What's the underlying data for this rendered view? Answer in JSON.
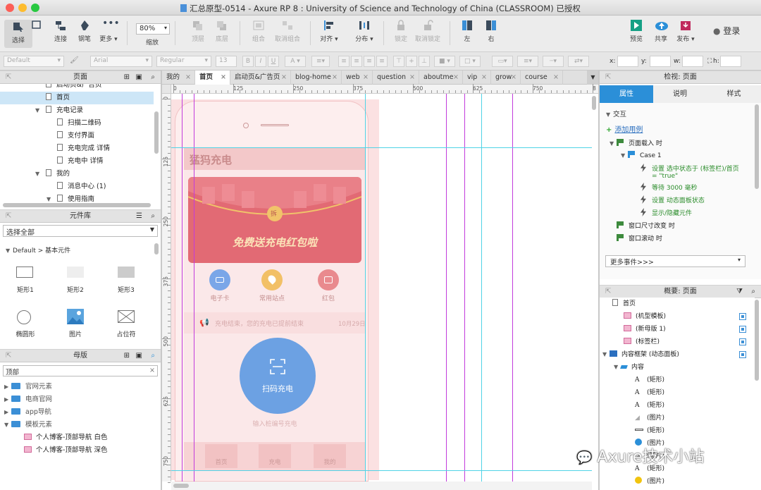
{
  "window": {
    "title": "汇总原型-0514 - Axure RP 8 : University of Science and Technology of China (CLASSROOM) 已授权"
  },
  "toolbar": {
    "select": "选择",
    "connect": "连接",
    "pen": "钢笔",
    "more": "更多",
    "zoom": "80%",
    "zoom_label": "缩放",
    "top": "顶层",
    "bottom": "底层",
    "group": "组合",
    "ungroup": "取消组合",
    "align": "对齐",
    "distribute": "分布",
    "lock": "锁定",
    "unlock": "取消锁定",
    "left": "左",
    "right": "右",
    "preview": "预览",
    "share": "共享",
    "publish": "发布",
    "login": "登录"
  },
  "format": {
    "style": "Default",
    "font": "Arial",
    "weight": "Regular",
    "size": "13",
    "x": "x:",
    "y": "y:",
    "w": "w:",
    "h": "h:"
  },
  "pages_panel": {
    "title": "页面",
    "items": [
      {
        "label": "启动页&广告页",
        "indent": 1,
        "toggle": ""
      },
      {
        "label": "首页",
        "indent": 1,
        "toggle": "",
        "selected": true
      },
      {
        "label": "充电记录",
        "indent": 1,
        "toggle": "▼"
      },
      {
        "label": "扫描二维码",
        "indent": 2,
        "toggle": ""
      },
      {
        "label": "支付界面",
        "indent": 2,
        "toggle": ""
      },
      {
        "label": "充电完成 详情",
        "indent": 2,
        "toggle": ""
      },
      {
        "label": "充电中 详情",
        "indent": 2,
        "toggle": ""
      },
      {
        "label": "我的",
        "indent": 1,
        "toggle": "▼"
      },
      {
        "label": "消息中心 (1)",
        "indent": 2,
        "toggle": ""
      },
      {
        "label": "使用指南",
        "indent": 2,
        "toggle": "▼"
      }
    ]
  },
  "widgets_panel": {
    "title": "元件库",
    "select_all": "选择全部",
    "library": "Default > 基本元件",
    "items": [
      "矩形1",
      "矩形2",
      "矩形3",
      "椭圆形",
      "图片",
      "占位符"
    ]
  },
  "masters_panel": {
    "title": "母版",
    "search": "顶部",
    "items": [
      {
        "label": "官网元素",
        "type": "folder",
        "indent": 0
      },
      {
        "label": "电商官网",
        "type": "folder",
        "indent": 0
      },
      {
        "label": "app导航",
        "type": "folder",
        "indent": 0
      },
      {
        "label": "模板元素",
        "type": "folder",
        "indent": 0,
        "open": true
      },
      {
        "label": "个人博客-顶部导航 白色",
        "type": "master",
        "indent": 1
      },
      {
        "label": "个人博客-顶部导航 深色",
        "type": "master",
        "indent": 1
      }
    ]
  },
  "tabs": [
    "我的",
    "首页",
    "启动页&广告页",
    "blog-home",
    "web",
    "question",
    "aboutme",
    "vip",
    "grow",
    "course"
  ],
  "ruler": {
    "h": [
      "0",
      "125",
      "250",
      "375",
      "500",
      "625",
      "750",
      "8"
    ],
    "v": [
      "0",
      "125",
      "250",
      "375",
      "500",
      "625",
      "750"
    ]
  },
  "mockup": {
    "header": "猛犸充电",
    "banner_text": "免费送充电红包啦",
    "banner_badge": "拆",
    "icons": [
      {
        "label": "电子卡",
        "color": "#5b8de0"
      },
      {
        "label": "常用站点",
        "color": "#f0b23a"
      },
      {
        "label": "红包",
        "color": "#e05a5a"
      }
    ],
    "notice": "充电结束，您的充电已提前结束",
    "notice_date": "10月29日",
    "scan_label": "扫码充电",
    "input_hint": "输入桩编号充电",
    "nav": [
      "首页",
      "充电",
      "我的"
    ]
  },
  "inspector": {
    "title": "检视: 页面",
    "tabs": [
      "属性",
      "说明",
      "样式"
    ],
    "interactions": "交互",
    "add_case": "添加用例",
    "events": [
      {
        "text": "页面载入 时",
        "level": 0,
        "type": "event"
      },
      {
        "text": "Case 1",
        "level": 1,
        "type": "case"
      },
      {
        "text": "设置 选中状态于 (标签栏)/首页",
        "extra": "= \"true\"",
        "level": 2,
        "type": "action"
      },
      {
        "text": "等待 3000 毫秒",
        "level": 2,
        "type": "action"
      },
      {
        "text": "设置 动态面板状态",
        "level": 2,
        "type": "action"
      },
      {
        "text": "显示/隐藏元件",
        "level": 2,
        "type": "action"
      },
      {
        "text": "窗口尺寸改变 时",
        "level": 0,
        "type": "event"
      },
      {
        "text": "窗口滚动 时",
        "level": 0,
        "type": "event"
      }
    ],
    "more_events": "更多事件>>>"
  },
  "outline": {
    "title": "概要: 页面",
    "items": [
      {
        "label": "首页",
        "indent": 0,
        "icon": "page"
      },
      {
        "label": "(机型模板)",
        "indent": 1,
        "icon": "master",
        "box": true
      },
      {
        "label": "(新母版 1)",
        "indent": 1,
        "icon": "master",
        "box": true
      },
      {
        "label": "(标签栏)",
        "indent": 1,
        "icon": "master",
        "box": true
      },
      {
        "label": "内容框架 (动态面板)",
        "indent": 0,
        "icon": "panel",
        "box": true,
        "toggle": "▼"
      },
      {
        "label": "内容",
        "indent": 1,
        "icon": "state",
        "toggle": "▼"
      },
      {
        "label": "(矩形)",
        "indent": 2,
        "icon": "A"
      },
      {
        "label": "(矩形)",
        "indent": 2,
        "icon": "A"
      },
      {
        "label": "(矩形)",
        "indent": 2,
        "icon": "A"
      },
      {
        "label": "(图片)",
        "indent": 2,
        "icon": "img"
      },
      {
        "label": "(矩形)",
        "indent": 2,
        "icon": "line"
      },
      {
        "label": "(图片)",
        "indent": 2,
        "icon": "circle"
      },
      {
        "label": "(图片)",
        "indent": 2,
        "icon": "img"
      },
      {
        "label": "(矩形)",
        "indent": 2,
        "icon": "A"
      },
      {
        "label": "(图片)",
        "indent": 2,
        "icon": "yellow"
      }
    ]
  },
  "watermark": "Axure技术小站"
}
